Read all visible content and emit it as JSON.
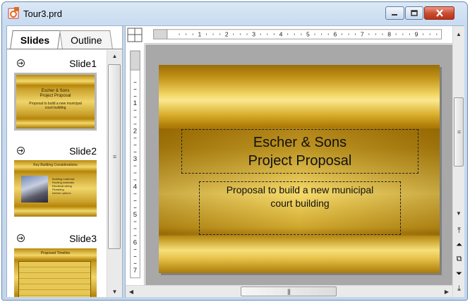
{
  "window": {
    "title": "Tour3.prd"
  },
  "tabs": [
    {
      "label": "Slides",
      "active": true
    },
    {
      "label": "Outline",
      "active": false
    }
  ],
  "slides": [
    {
      "label": "Slide1",
      "lines": [
        "Escher & Sons",
        "Project Proposal",
        "Proposal to build a new municipal",
        "court building"
      ]
    },
    {
      "label": "Slide2",
      "title": "Key Building Considerations",
      "bullets": [
        "Building materials",
        "Roofing materials",
        "Electrical wiring",
        "Plumbing",
        "Interior options"
      ]
    },
    {
      "label": "Slide3",
      "title": "Proposed Timeline"
    }
  ],
  "main_slide": {
    "title_line1": "Escher & Sons",
    "title_line2": "Project Proposal",
    "subtitle_line1": "Proposal to build a new municipal",
    "subtitle_line2": "court building"
  },
  "ruler_h_numbers": [
    "1",
    "2",
    "3",
    "4",
    "5",
    "6",
    "7",
    "8",
    "9"
  ],
  "ruler_v_numbers": [
    "1",
    "2",
    "3",
    "4",
    "5",
    "6",
    "7"
  ],
  "colors": {
    "slide_gold": "#e3b93a",
    "slide_dark": "#9b6e06",
    "title_bar": "#c9dcf0",
    "close_red": "#c94a2e"
  },
  "icons": [
    "app-icon",
    "minimize-icon",
    "maximize-icon",
    "close-icon",
    "slide-transition-icon",
    "ruler-corner-icon",
    "previous-slide-icon",
    "next-slide-icon",
    "fit-icon"
  ]
}
